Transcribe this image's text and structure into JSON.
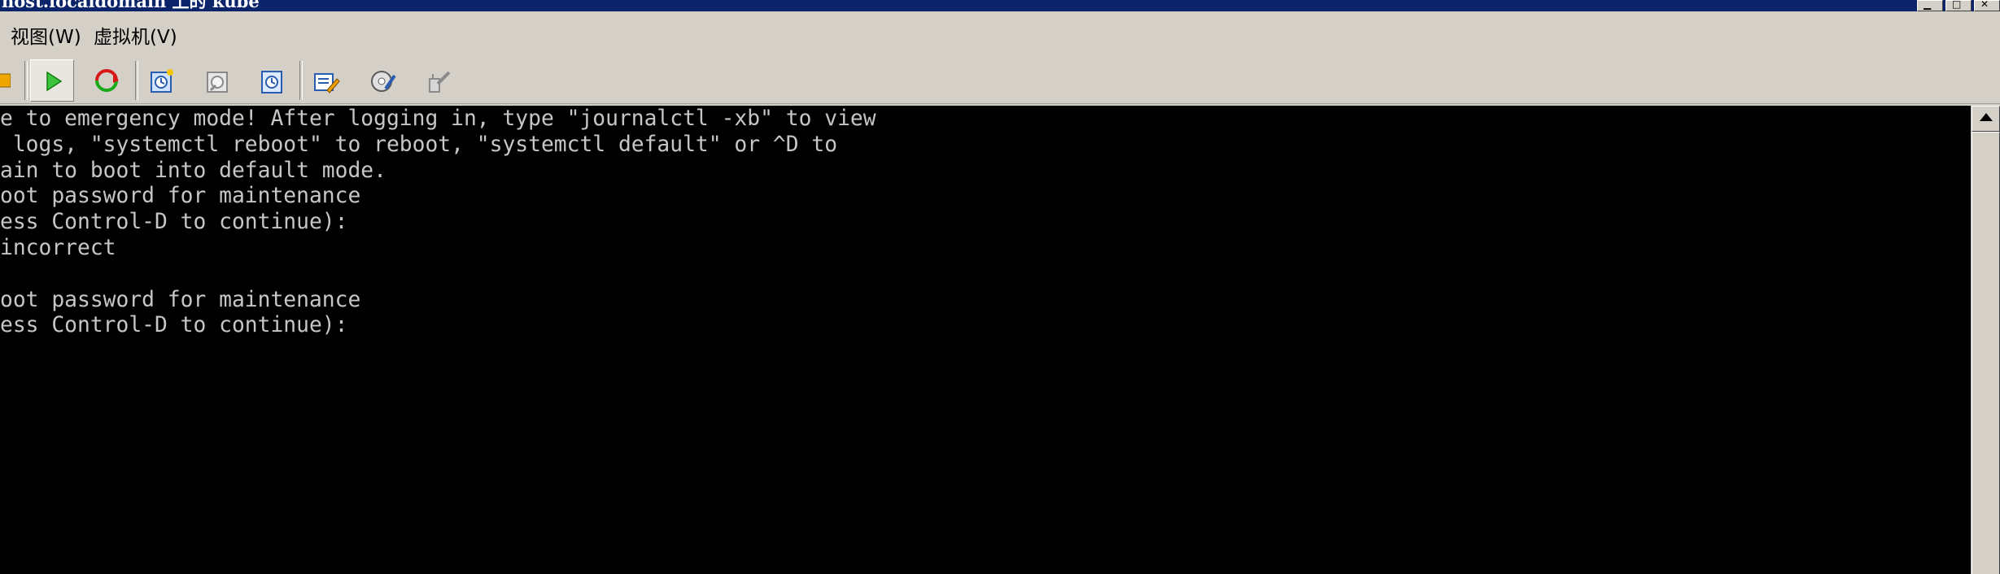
{
  "window": {
    "title": "host.localdomain 上的 kube",
    "colors": {
      "titlebar": "#0b246a",
      "console_bg": "#000000",
      "console_fg": "#c6c6c6"
    }
  },
  "menu": [
    {
      "label": "视图(W)"
    },
    {
      "label": "虚拟机(V)"
    }
  ],
  "toolbar": {
    "icons": [
      "stop-icon",
      "power-on-icon",
      "reset-icon",
      "snapshot-icon",
      "revert-snapshot-icon",
      "manage-snapshots-icon",
      "edit-settings-icon",
      "connect-device-icon",
      "disconnect-device-icon"
    ]
  },
  "console": {
    "text": "e to emergency mode! After logging in, type \"journalctl -xb\" to view\n logs, \"systemctl reboot\" to reboot, \"systemctl default\" or ^D to\nain to boot into default mode.\noot password for maintenance\ness Control-D to continue):\nincorrect\n\noot password for maintenance\ness Control-D to continue):"
  }
}
